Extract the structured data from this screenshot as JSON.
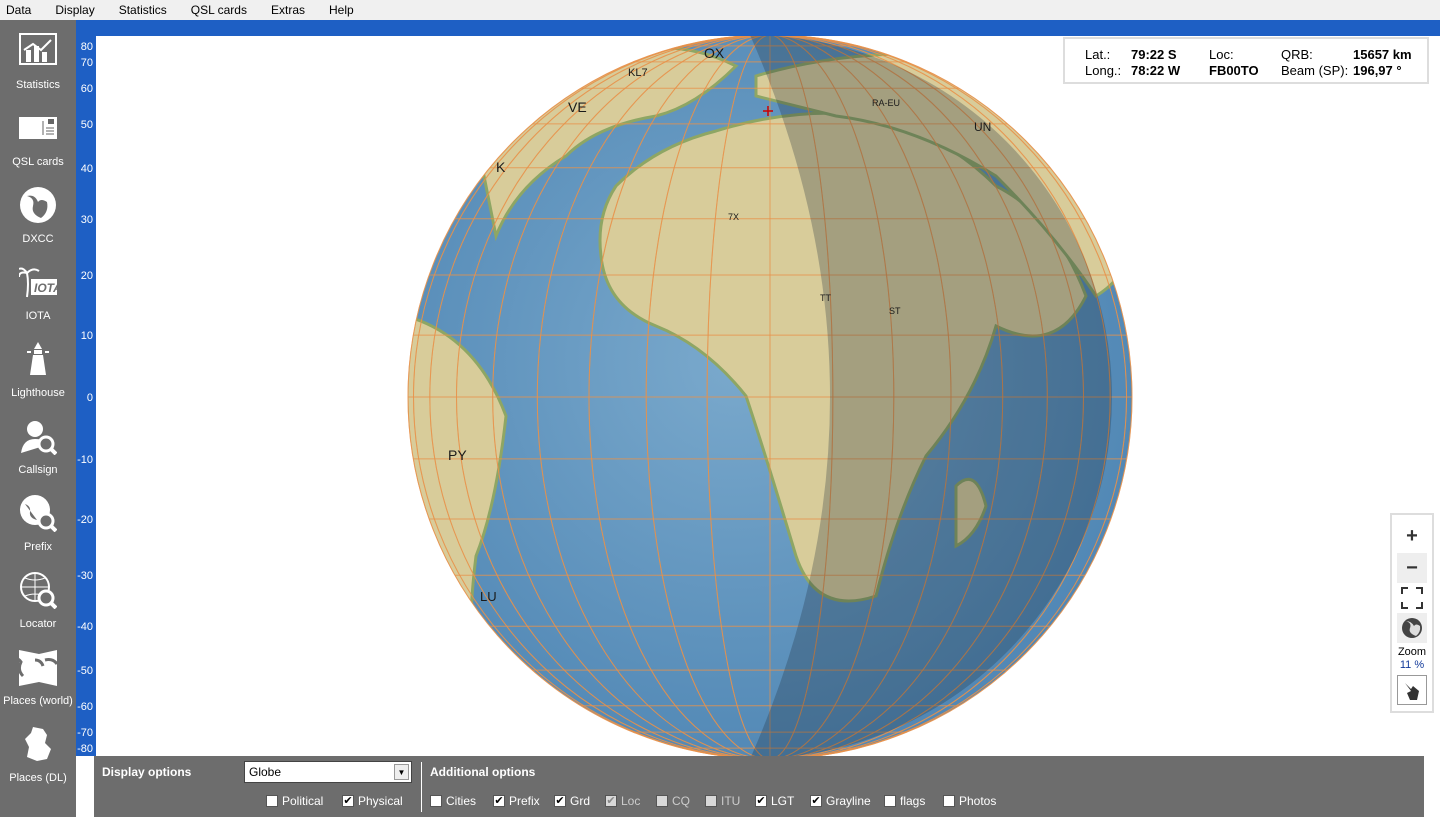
{
  "menu": [
    "Data",
    "Display",
    "Statistics",
    "QSL cards",
    "Extras",
    "Help"
  ],
  "sidebar": [
    {
      "label": "Statistics",
      "icon": "statistics-icon"
    },
    {
      "label": "QSL cards",
      "icon": "qsl-card-icon"
    },
    {
      "label": "DXCC",
      "icon": "globe-icon"
    },
    {
      "label": "IOTA",
      "icon": "iota-palm-icon"
    },
    {
      "label": "Lighthouse",
      "icon": "lighthouse-icon"
    },
    {
      "label": "Callsign",
      "icon": "callsign-search-icon"
    },
    {
      "label": "Prefix",
      "icon": "prefix-search-icon"
    },
    {
      "label": "Locator",
      "icon": "locator-search-icon"
    },
    {
      "label": "Places (world)",
      "icon": "world-map-icon"
    },
    {
      "label": "Places (DL)",
      "icon": "germany-map-icon"
    }
  ],
  "lat_ticks": [
    "80",
    "70",
    "60",
    "50",
    "40",
    "30",
    "20",
    "10",
    "0",
    "-10",
    "-20",
    "-30",
    "-40",
    "-50",
    "-60",
    "-70",
    "-80"
  ],
  "info": {
    "lat_label": "Lat.:",
    "lat": "79:22 S",
    "long_label": "Long.:",
    "long": "78:22 W",
    "loc_label": "Loc:",
    "loc": "FB00TO",
    "qrb_label": "QRB:",
    "qrb": "15657 km",
    "beam_label": "Beam (SP):",
    "beam": "196,97 °"
  },
  "map_labels": [
    "OX",
    "KL7",
    "VE",
    "K",
    "RA-EU",
    "UN",
    "7X",
    "TT",
    "ST",
    "PY",
    "LU"
  ],
  "zoom": {
    "label": "Zoom",
    "value": "11 %"
  },
  "bottom": {
    "display_options": "Display options",
    "select_value": "Globe",
    "additional_options": "Additional options",
    "display_checks": [
      {
        "label": "Political",
        "checked": false
      },
      {
        "label": "Physical",
        "checked": true
      }
    ],
    "additional_checks": [
      {
        "label": "Cities",
        "checked": false,
        "disabled": false
      },
      {
        "label": "Prefix",
        "checked": true,
        "disabled": false
      },
      {
        "label": "Grd",
        "checked": true,
        "disabled": false
      },
      {
        "label": "Loc",
        "checked": true,
        "disabled": true
      },
      {
        "label": "CQ",
        "checked": false,
        "disabled": true
      },
      {
        "label": "ITU",
        "checked": false,
        "disabled": true
      },
      {
        "label": "LGT",
        "checked": true,
        "disabled": false
      },
      {
        "label": "Grayline",
        "checked": true,
        "disabled": false
      },
      {
        "label": "flags",
        "checked": false,
        "disabled": false
      },
      {
        "label": "Photos",
        "checked": false,
        "disabled": false
      }
    ]
  },
  "colors": {
    "sidebar": "#6d6d6d",
    "accent": "#1e5fc4",
    "ocean": "#4f86b4",
    "land": "#d8cc9a",
    "grid": "#e8924a"
  }
}
